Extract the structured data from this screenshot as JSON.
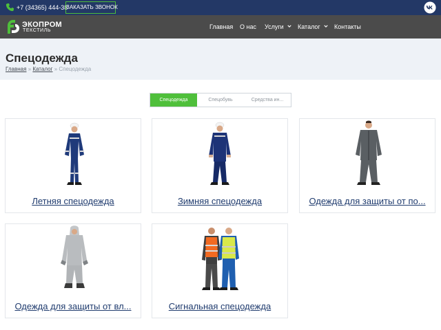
{
  "topbar": {
    "phone": "+7 (34365) 444-38",
    "callback_label": "ЗАКАЗАТЬ ЗВОНОК",
    "icons": [
      "phone-icon",
      "vk-icon"
    ]
  },
  "header": {
    "logo_name": "ЭКОПРОМ",
    "logo_sub": "ТЕКСТИЛЬ",
    "nav": [
      {
        "label": "Главная",
        "dropdown": false
      },
      {
        "label": "О нас",
        "dropdown": false
      },
      {
        "label": "Услуги",
        "dropdown": true
      },
      {
        "label": "Каталог",
        "dropdown": true
      },
      {
        "label": "Контакты",
        "dropdown": false
      }
    ]
  },
  "page": {
    "title": "Спецодежда",
    "breadcrumb": [
      {
        "label": "Главная",
        "link": true
      },
      {
        "label": "Каталог",
        "link": true
      },
      {
        "label": "Спецодежда",
        "link": false
      }
    ],
    "breadcrumb_separator": "»"
  },
  "tabs": [
    {
      "label": "Спецодежда",
      "active": true
    },
    {
      "label": "Спецобувь",
      "active": false
    },
    {
      "label": "Средства ин...",
      "active": false
    }
  ],
  "cards": [
    {
      "label": "Летняя спецодежда",
      "image": "summer-workwear-image"
    },
    {
      "label": "Зимняя спецодежда",
      "image": "winter-workwear-image"
    },
    {
      "label": "Одежда для защиты от по...",
      "image": "protective-suit-grey-image"
    },
    {
      "label": "Одежда для защиты от вл...",
      "image": "moisture-protection-suit-image"
    },
    {
      "label": "Сигнальная спецодежда",
      "image": "signal-workwear-image"
    }
  ],
  "colors": {
    "topbar": "#233866",
    "header": "#4b4b4b",
    "accent_green": "#4fbf3b",
    "title_bg": "#eef2f7",
    "card_link": "#1f3b6e"
  }
}
